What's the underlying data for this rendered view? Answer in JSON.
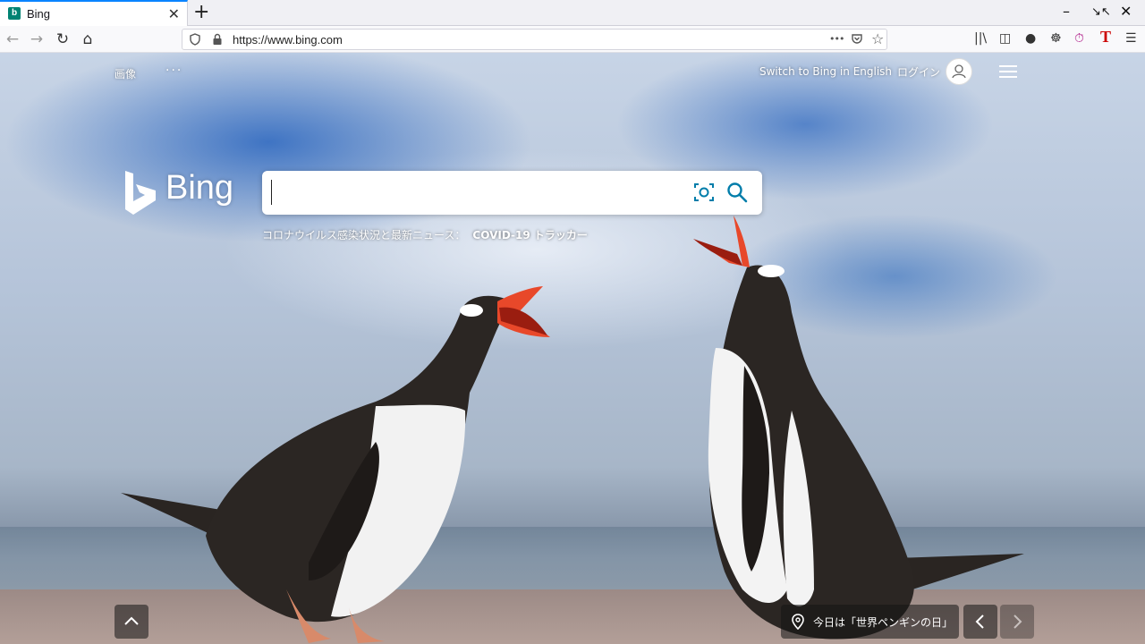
{
  "browser": {
    "tab_title": "Bing",
    "favicon_letter": "b",
    "close_glyph": "✕",
    "newtab_glyph": "+",
    "url": "https://www.bing.com",
    "url_more_glyph": "•••"
  },
  "header": {
    "images_link": "画像",
    "more_glyph": "···",
    "switch_language": "Switch to Bing in English",
    "login": "ログイン"
  },
  "logo": {
    "text": "Bing"
  },
  "search": {
    "placeholder": ""
  },
  "news": {
    "prefix": "コロナウイルス感染状況と最新ニュース：",
    "link": "COVID-19 トラッカー"
  },
  "caption": {
    "text": "今日は「世界ペンギンの日」"
  },
  "colors": {
    "accent": "#007daa",
    "brand": "#008373",
    "firefox_tab": "#0a84ff"
  },
  "icons": {
    "back": "arrow-left-icon",
    "forward": "arrow-right-icon",
    "reload": "reload-icon",
    "home": "home-icon",
    "shield": "shield-icon",
    "lock": "lock-icon",
    "pocket": "pocket-icon",
    "star": "star-icon",
    "visual_search": "camera-icon",
    "search": "search-icon",
    "location": "location-pin-icon"
  }
}
